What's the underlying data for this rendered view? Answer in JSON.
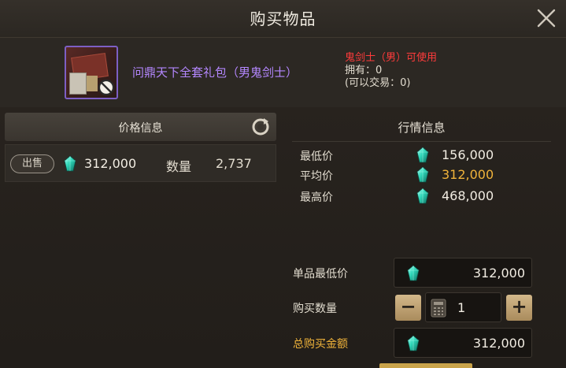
{
  "dialog": {
    "title": "购买物品"
  },
  "item": {
    "name": "问鼎天下全套礼包（男鬼剑士）",
    "class_requirement": "鬼剑士（男）可使用",
    "owned": "拥有：0",
    "tradable": "(可以交易：0)"
  },
  "price_info": {
    "header": "价格信息",
    "listing": {
      "badge": "出售",
      "price": "312,000",
      "qty_label": "数量",
      "qty_value": "2,737"
    }
  },
  "market_info": {
    "header": "行情信息",
    "rows": [
      {
        "label": "最低价",
        "value": "156,000"
      },
      {
        "label": "平均价",
        "value": "312,000"
      },
      {
        "label": "最高价",
        "value": "468,000"
      }
    ]
  },
  "purchase": {
    "unit_price_label": "单品最低价",
    "unit_price": "312,000",
    "quantity_label": "购买数量",
    "quantity": "1",
    "minus": "−",
    "plus": "+",
    "total_label": "总购买金额",
    "total": "312,000"
  },
  "colors": {
    "accent_gold": "#f0b33a",
    "item_name_purple": "#b487ff",
    "requirement_red": "#ff3b3b",
    "gem_teal": "#2fd6b8"
  },
  "icons": {
    "close": "close-icon",
    "refresh": "refresh-icon",
    "gem": "gem-icon",
    "calculator": "calculator-icon",
    "no_trade": "no-trade-icon"
  }
}
